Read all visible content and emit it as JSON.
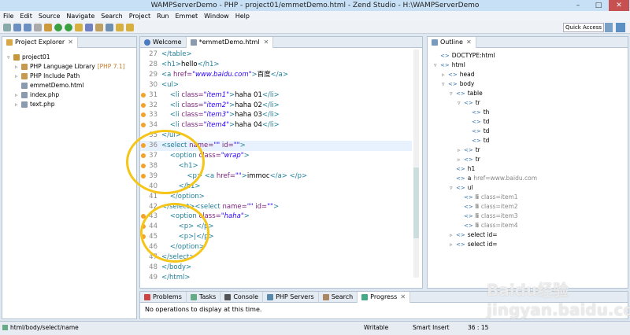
{
  "window": {
    "title": "WAMPServerDemo - PHP - project01/emmetDemo.html - Zend Studio - H:\\WAMPServerDemo"
  },
  "menu": [
    "File",
    "Edit",
    "Source",
    "Navigate",
    "Search",
    "Project",
    "Run",
    "Emmet",
    "Window",
    "Help"
  ],
  "quick_access": "Quick Access",
  "explorer": {
    "title": "Project Explorer",
    "items": [
      {
        "label": "project01",
        "indent": 0,
        "arrow": "▿"
      },
      {
        "label": "PHP Language Library",
        "extra": "[PHP 7.1]",
        "indent": 1,
        "arrow": "▹"
      },
      {
        "label": "PHP Include Path",
        "indent": 1,
        "arrow": "▹"
      },
      {
        "label": "emmetDemo.html",
        "indent": 1,
        "arrow": ""
      },
      {
        "label": "index.php",
        "indent": 1,
        "arrow": "▹"
      },
      {
        "label": "text.php",
        "indent": 1,
        "arrow": "▹"
      }
    ]
  },
  "editor": {
    "tabs": [
      "Welcome",
      "*emmetDemo.html"
    ],
    "lines": [
      {
        "n": "27",
        "s": [
          [
            "tag",
            "</table>"
          ]
        ]
      },
      {
        "n": "28",
        "s": [
          [
            "tag",
            "<h1>"
          ],
          [
            "txt",
            "hello"
          ],
          [
            "tag",
            "</h1>"
          ]
        ]
      },
      {
        "n": "29",
        "s": [
          [
            "tag",
            "<a "
          ],
          [
            "attr",
            "href="
          ],
          [
            "str",
            "\"www.baidu.com\""
          ],
          [
            "tag",
            ">"
          ],
          [
            "txt",
            "百度"
          ],
          [
            "tag",
            "</a>"
          ]
        ]
      },
      {
        "n": "30",
        "s": [
          [
            "tag",
            "<ul>"
          ]
        ]
      },
      {
        "n": "31",
        "w": true,
        "s": [
          [
            "tag",
            "    <li "
          ],
          [
            "attr",
            "class="
          ],
          [
            "str",
            "\"item1\""
          ],
          [
            "tag",
            ">"
          ],
          [
            "txt",
            "haha 01"
          ],
          [
            "tag",
            "</li>"
          ]
        ]
      },
      {
        "n": "32",
        "w": true,
        "s": [
          [
            "tag",
            "    <li "
          ],
          [
            "attr",
            "class="
          ],
          [
            "str",
            "\"item2\""
          ],
          [
            "tag",
            ">"
          ],
          [
            "txt",
            "haha 02"
          ],
          [
            "tag",
            "</li>"
          ]
        ]
      },
      {
        "n": "33",
        "w": true,
        "s": [
          [
            "tag",
            "    <li "
          ],
          [
            "attr",
            "class="
          ],
          [
            "str",
            "\"item3\""
          ],
          [
            "tag",
            ">"
          ],
          [
            "txt",
            "haha 03"
          ],
          [
            "tag",
            "</li>"
          ]
        ]
      },
      {
        "n": "34",
        "w": true,
        "s": [
          [
            "tag",
            "    <li "
          ],
          [
            "attr",
            "class="
          ],
          [
            "str",
            "\"item4\""
          ],
          [
            "tag",
            ">"
          ],
          [
            "txt",
            "haha 04"
          ],
          [
            "tag",
            "</li>"
          ]
        ]
      },
      {
        "n": "35",
        "s": [
          [
            "tag",
            "</ul>"
          ]
        ]
      },
      {
        "n": "36",
        "w": true,
        "hl": true,
        "s": [
          [
            "tag",
            "<select "
          ],
          [
            "attr",
            "name="
          ],
          [
            "str",
            "\"\""
          ],
          [
            "attr",
            " id="
          ],
          [
            "str",
            "\"\""
          ],
          [
            "tag",
            ">"
          ]
        ]
      },
      {
        "n": "37",
        "w": true,
        "s": [
          [
            "tag",
            "    <option "
          ],
          [
            "attr",
            "class="
          ],
          [
            "str",
            "\"wrap\""
          ],
          [
            "tag",
            ">"
          ]
        ]
      },
      {
        "n": "38",
        "w": true,
        "s": [
          [
            "tag",
            "        <h1>"
          ]
        ]
      },
      {
        "n": "39",
        "w": true,
        "s": [
          [
            "tag",
            "            <p> "
          ],
          [
            "tag",
            "<a "
          ],
          [
            "attr",
            "href="
          ],
          [
            "str",
            "\"\""
          ],
          [
            "tag",
            ">"
          ],
          [
            "txt",
            "immoc"
          ],
          [
            "tag",
            "</a> </p>"
          ]
        ]
      },
      {
        "n": "40",
        "s": [
          [
            "tag",
            "        </h1>"
          ]
        ]
      },
      {
        "n": "41",
        "s": [
          [
            "tag",
            "    </option>"
          ]
        ]
      },
      {
        "n": "42",
        "s": [
          [
            "tag",
            "</select>"
          ],
          [
            "tag",
            "<select "
          ],
          [
            "attr",
            "name="
          ],
          [
            "str",
            "\"\""
          ],
          [
            "attr",
            " id="
          ],
          [
            "str",
            "\"\""
          ],
          [
            "tag",
            ">"
          ]
        ]
      },
      {
        "n": "43",
        "w": true,
        "s": [
          [
            "tag",
            "    <option "
          ],
          [
            "attr",
            "class="
          ],
          [
            "str",
            "\"haha\""
          ],
          [
            "tag",
            ">"
          ]
        ]
      },
      {
        "n": "44",
        "w": true,
        "s": [
          [
            "tag",
            "        <p> </p>"
          ]
        ]
      },
      {
        "n": "45",
        "w": true,
        "s": [
          [
            "tag",
            "        <p>|</p>"
          ]
        ]
      },
      {
        "n": "46",
        "s": [
          [
            "tag",
            "    </option>"
          ]
        ]
      },
      {
        "n": "47",
        "s": [
          [
            "tag",
            "</select>"
          ]
        ]
      },
      {
        "n": "48",
        "s": [
          [
            "tag",
            "</body>"
          ]
        ]
      },
      {
        "n": "49",
        "s": [
          [
            "tag",
            "</html>"
          ]
        ]
      }
    ]
  },
  "outline": {
    "title": "Outline",
    "items": [
      {
        "label": "DOCTYPE:html",
        "indent": 0,
        "arrow": ""
      },
      {
        "label": "html",
        "indent": 0,
        "arrow": "▿"
      },
      {
        "label": "head",
        "indent": 1,
        "arrow": "▹"
      },
      {
        "label": "body",
        "indent": 1,
        "arrow": "▿"
      },
      {
        "label": "table",
        "indent": 2,
        "arrow": "▿"
      },
      {
        "label": "tr",
        "indent": 3,
        "arrow": "▿"
      },
      {
        "label": "th",
        "indent": 4,
        "arrow": ""
      },
      {
        "label": "td",
        "indent": 4,
        "arrow": ""
      },
      {
        "label": "td",
        "indent": 4,
        "arrow": ""
      },
      {
        "label": "td",
        "indent": 4,
        "arrow": ""
      },
      {
        "label": "tr",
        "indent": 3,
        "arrow": "▹"
      },
      {
        "label": "tr",
        "indent": 3,
        "arrow": "▹"
      },
      {
        "label": "h1",
        "indent": 2,
        "arrow": ""
      },
      {
        "label": "a",
        "extra": "href=www.baidu.com",
        "indent": 2,
        "arrow": ""
      },
      {
        "label": "ul",
        "indent": 2,
        "arrow": "▿"
      },
      {
        "label": "li",
        "extra": "class=item1",
        "indent": 3,
        "arrow": ""
      },
      {
        "label": "li",
        "extra": "class=item2",
        "indent": 3,
        "arrow": ""
      },
      {
        "label": "li",
        "extra": "class=item3",
        "indent": 3,
        "arrow": ""
      },
      {
        "label": "li",
        "extra": "class=item4",
        "indent": 3,
        "arrow": ""
      },
      {
        "label": "select id=",
        "indent": 2,
        "arrow": "▹"
      },
      {
        "label": "select id=",
        "indent": 2,
        "arrow": "▹"
      }
    ]
  },
  "bottom": {
    "tabs": [
      "Problems",
      "Tasks",
      "Console",
      "PHP Servers",
      "Search",
      "Progress"
    ],
    "message": "No operations to display at this time."
  },
  "status": {
    "path": "html/body/select/name",
    "mode": "Writable",
    "insert": "Smart Insert",
    "pos": "36 : 15"
  },
  "watermark": "Baidu经验 jingyan.baidu.com"
}
